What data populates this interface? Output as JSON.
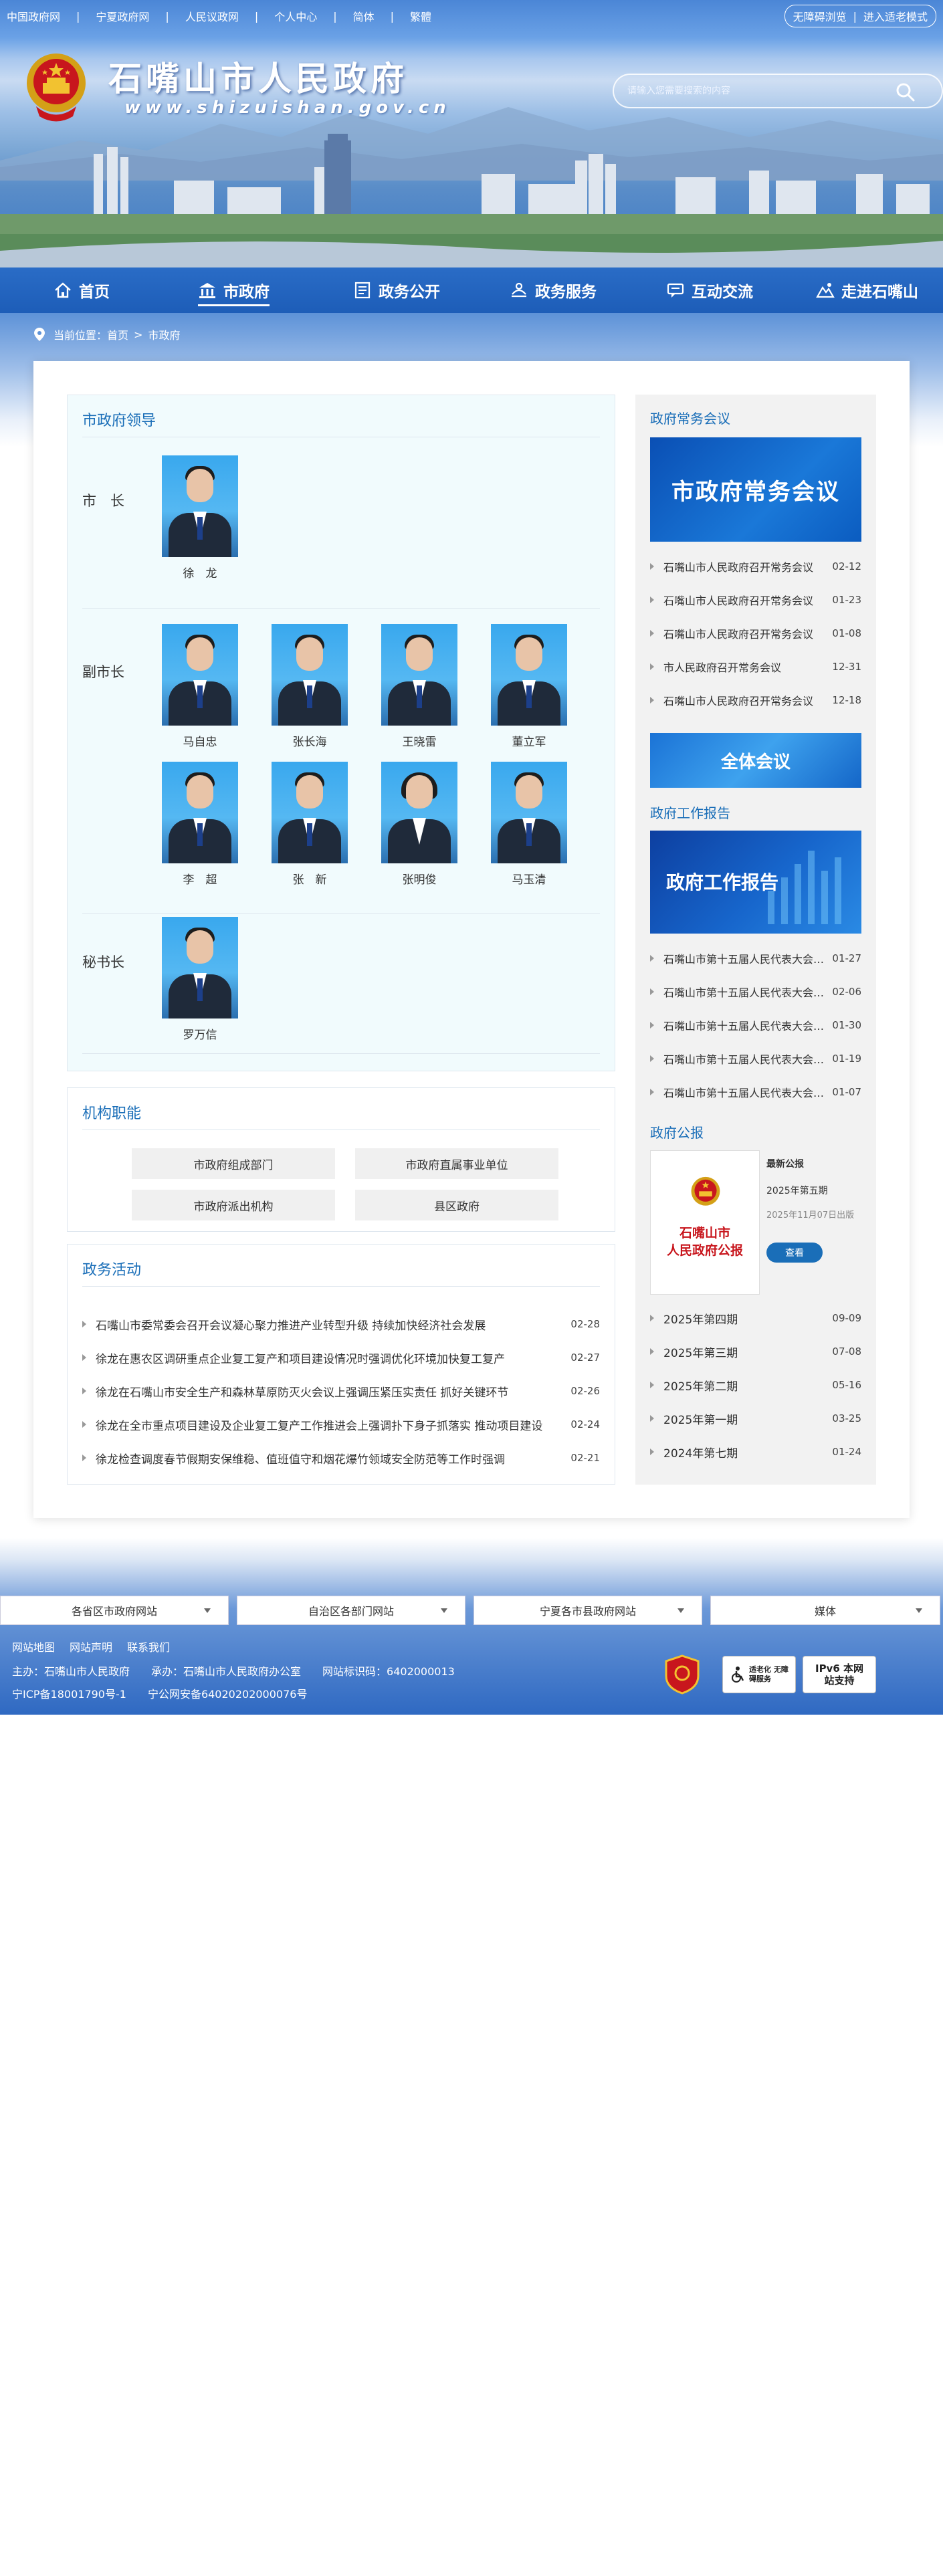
{
  "topbar": {
    "links": [
      "中国政府网",
      "宁夏政府网",
      "人民议政网",
      "个人中心",
      "简体",
      "繁體"
    ],
    "accessibility": "无障碍浏览",
    "elder_mode": "进入适老模式"
  },
  "header": {
    "title": "石嘴山市人民政府",
    "url": "www.shizuishan.gov.cn",
    "search_placeholder": "请输入您需要搜索的内容"
  },
  "nav": [
    "首页",
    "市政府",
    "政务公开",
    "政务服务",
    "互动交流",
    "走进石嘴山"
  ],
  "breadcrumb": {
    "label": "当前位置：",
    "home": "首页",
    "sep": ">",
    "current": "市政府"
  },
  "leaders": {
    "title": "市政府领导",
    "mayor_label": "市　长",
    "mayor": "徐　龙",
    "vice_label": "副市长",
    "vices": [
      "马自忠",
      "张长海",
      "王晓雷",
      "董立军",
      "李　超",
      "张　新",
      "张明俊",
      "马玉清"
    ],
    "secretary_label": "秘书长",
    "secretary": "罗万信"
  },
  "functions": {
    "title": "机构职能",
    "buttons": [
      "市政府组成部门",
      "市政府直属事业单位",
      "市政府派出机构",
      "县区政府"
    ]
  },
  "activities": {
    "title": "政务活动",
    "items": [
      {
        "t": "石嘴山市委常委会召开会议凝心聚力推进产业转型升级 持续加快经济社会发展",
        "d": "02-28"
      },
      {
        "t": "徐龙在惠农区调研重点企业复工复产和项目建设情况时强调优化环境加快复工复产",
        "d": "02-27"
      },
      {
        "t": "徐龙在石嘴山市安全生产和森林草原防灭火会议上强调压紧压实责任 抓好关键环节",
        "d": "02-26"
      },
      {
        "t": "徐龙在全市重点项目建设及企业复工复产工作推进会上强调扑下身子抓落实 推动项目建设",
        "d": "02-24"
      },
      {
        "t": "徐龙检查调度春节假期安保维稳、值班值守和烟花爆竹领域安全防范等工作时强调",
        "d": "02-21"
      }
    ]
  },
  "sidebar": {
    "meeting_title": "政府常务会议",
    "meeting_banner": "市政府常务会议",
    "meetings": [
      {
        "t": "石嘴山市人民政府召开常务会议",
        "d": "02-12"
      },
      {
        "t": "石嘴山市人民政府召开常务会议",
        "d": "01-23"
      },
      {
        "t": "石嘴山市人民政府召开常务会议",
        "d": "01-08"
      },
      {
        "t": "市人民政府召开常务会议",
        "d": "12-31"
      },
      {
        "t": "石嘴山市人民政府召开常务会议",
        "d": "12-18"
      }
    ],
    "plenary_banner": "全体会议",
    "report_title": "政府工作报告",
    "report_banner": "政府工作报告",
    "reports": [
      {
        "t": "石嘴山市第十五届人民代表大会第五次会议政府工作报告",
        "d": "01-27"
      },
      {
        "t": "石嘴山市第十五届人民代表大会第四次会议政府工作报告",
        "d": "02-06"
      },
      {
        "t": "石嘴山市第十五届人民代表大会第三次会议政府工作报告",
        "d": "01-30"
      },
      {
        "t": "石嘴山市第十五届人民代表大会第二次会议政府工作报告",
        "d": "01-19"
      },
      {
        "t": "石嘴山市第十五届人民代表大会第一次会议政府工作报告",
        "d": "01-07"
      }
    ],
    "gazette_title": "政府公报",
    "gazette_cover_line1": "石嘴山市",
    "gazette_cover_line2": "人民政府公报",
    "gazette_label": "最新公报",
    "gazette_issue": "2025年第五期",
    "gazette_date": "2025年11月07日出版",
    "gazette_btn": "查看",
    "gazettes": [
      {
        "t": "2025年第四期",
        "d": "09-09"
      },
      {
        "t": "2025年第三期",
        "d": "07-08"
      },
      {
        "t": "2025年第二期",
        "d": "05-16"
      },
      {
        "t": "2025年第一期",
        "d": "03-25"
      },
      {
        "t": "2024年第七期",
        "d": "01-24"
      }
    ]
  },
  "footer": {
    "selects": [
      "各省区市政府网站",
      "自治区各部门网站",
      "宁夏各市县政府网站",
      "媒体"
    ],
    "links": [
      "网站地图",
      "网站声明",
      "联系我们"
    ],
    "host": "主办：石嘴山市人民政府",
    "organizer": "承办：石嘴山市人民政府办公室",
    "site_id": "网站标识码：6402000013",
    "icp": "宁ICP备18001790号-1",
    "police": "宁公网安备64020202000076号",
    "badge_elder": "适老化 无障碍服务",
    "badge_ipv6": "IPv6 本网站支持"
  }
}
